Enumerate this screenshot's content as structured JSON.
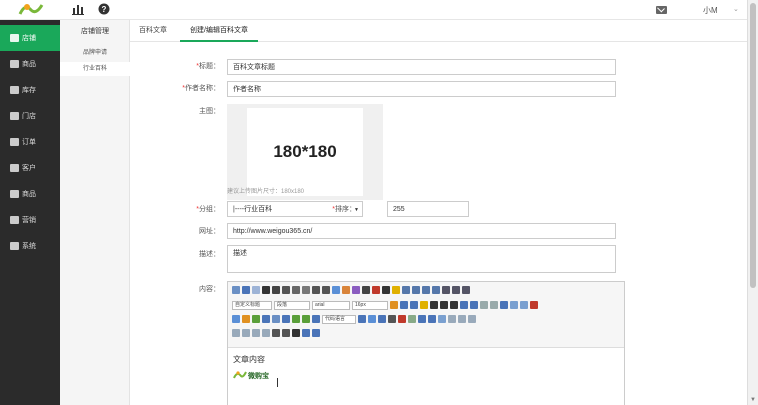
{
  "header": {
    "user_name": "小M",
    "user_caret": "⌄"
  },
  "sidebar": {
    "items": [
      {
        "label": "店铺",
        "icon": "store-icon",
        "active": true
      },
      {
        "label": "商品",
        "icon": "goods-icon",
        "active": false
      },
      {
        "label": "库存",
        "icon": "inventory-icon",
        "active": false
      },
      {
        "label": "门店",
        "icon": "shop-icon",
        "active": false
      },
      {
        "label": "订单",
        "icon": "order-icon",
        "active": false
      },
      {
        "label": "客户",
        "icon": "customer-icon",
        "active": false
      },
      {
        "label": "商品",
        "icon": "product-icon",
        "active": false
      },
      {
        "label": "营销",
        "icon": "marketing-icon",
        "active": false
      },
      {
        "label": "系统",
        "icon": "system-icon",
        "active": false
      }
    ]
  },
  "submenu": {
    "heading": "店铺管理",
    "items": [
      "品牌申请",
      "行业百科"
    ]
  },
  "tabs": [
    "百科文章",
    "创建/编辑百科文章"
  ],
  "form": {
    "title_label": "标题：",
    "title_value": "百科文章标题",
    "author_label": "作者名称：",
    "author_value": "作者名称",
    "image_label": "主图：",
    "image_placeholder": "180*180",
    "image_hint": "建议上传图片尺寸：180x180",
    "category_label": "分组：",
    "category_value": "|----行业百科",
    "sort_label": "排序：",
    "sort_value": "255",
    "url_label": "网址：",
    "url_value": "http://www.weigou365.cn/",
    "desc_label": "描述：",
    "desc_value": "描述",
    "content_label": "内容：",
    "content_text": "文章内容",
    "required_mark": "*"
  },
  "editor": {
    "font_style": "自定义标题",
    "paragraph": "段落",
    "font_family": "arial",
    "font_size": "16px",
    "code_lang": "代码语言",
    "logo_text": "微购宝"
  },
  "colors": {
    "accent": "#1aa85a",
    "sidebar_bg": "#2b2b2b",
    "required": "#ee3333"
  }
}
